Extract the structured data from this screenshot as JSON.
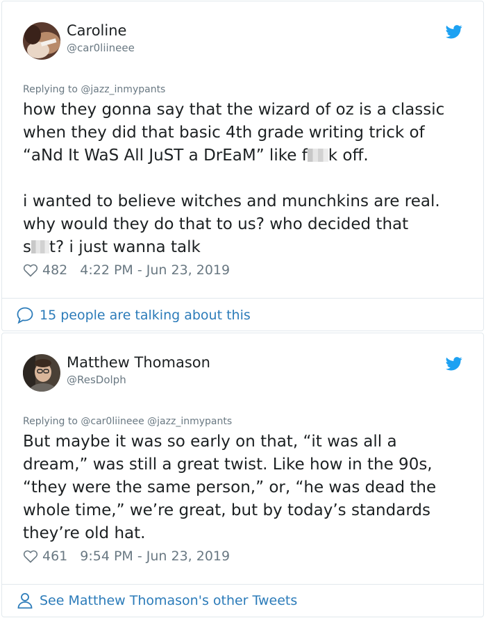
{
  "tweets": [
    {
      "name": "Caroline",
      "handle": "@car0liineee",
      "replying_to": "Replying to @jazz_inmypants",
      "text_lines": [
        "how they gonna say that the wizard of oz is a classic",
        "when they did that basic 4th grade writing trick of",
        "“aNd It WaS All JuST a DrEaM” like f",
        "k off.",
        "i wanted to believe witches and munchkins are real.",
        "why would they do that to us? who decided that",
        "s",
        "t? i just wanna talk"
      ],
      "likes": "482",
      "timestamp": "4:22 PM - Jun 23, 2019",
      "footer": "15 people are talking about this"
    },
    {
      "name": "Matthew Thomason",
      "handle": "@ResDolph",
      "replying_to": "Replying to @car0liineee @jazz_inmypants",
      "text_lines": [
        "But maybe it was so early on that, “it was all a",
        "dream,” was still a great twist. Like how in the 90s,",
        "“they were the same person,” or, “he was dead the",
        "whole time,” we’re great, but by today’s standards",
        "they’re old hat."
      ],
      "likes": "461",
      "timestamp": "9:54 PM - Jun 23, 2019",
      "footer": "See Matthew Thomason's other Tweets"
    }
  ],
  "icons": {
    "brand": "twitter-bird-icon",
    "like": "heart-icon",
    "conversation": "speech-bubble-icon",
    "profile": "person-icon"
  },
  "colors": {
    "twitter_blue": "#1da1f2",
    "link_blue": "#2b7bb9",
    "secondary_text": "#697882",
    "border": "#e1e8ed"
  }
}
